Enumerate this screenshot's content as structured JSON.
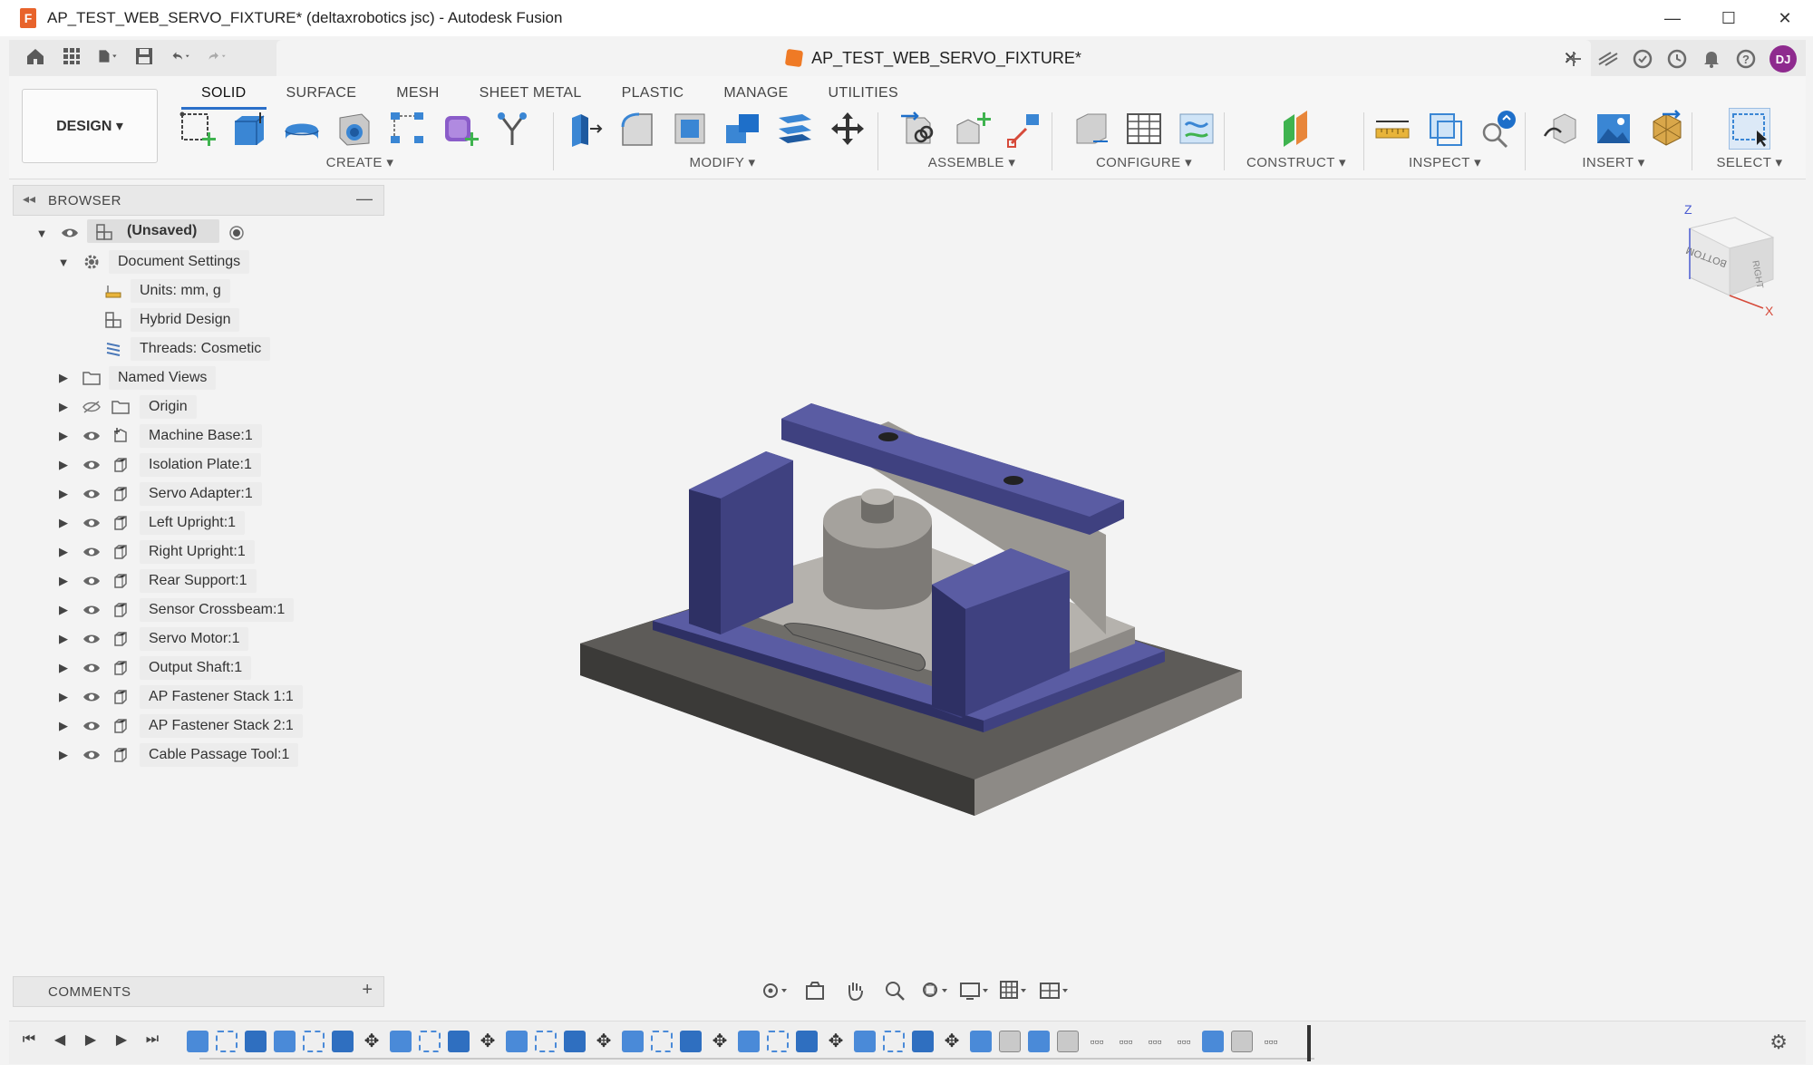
{
  "window": {
    "title": "AP_TEST_WEB_SERVO_FIXTURE* (deltaxrobotics jsc) - Autodesk Fusion",
    "logo_letter": "F",
    "minimize": "—",
    "maximize": "☐",
    "close": "✕"
  },
  "document_tab": {
    "title": "AP_TEST_WEB_SERVO_FIXTURE*",
    "close": "✕"
  },
  "user": {
    "initials": "DJ"
  },
  "toolbar": {
    "workspace_button": "DESIGN ▾",
    "tabs": [
      "SOLID",
      "SURFACE",
      "MESH",
      "SHEET METAL",
      "PLASTIC",
      "MANAGE",
      "UTILITIES"
    ],
    "active_tab": "SOLID",
    "groups": {
      "create": "CREATE ▾",
      "modify": "MODIFY ▾",
      "assemble": "ASSEMBLE ▾",
      "configure": "CONFIGURE ▾",
      "construct": "CONSTRUCT ▾",
      "inspect": "INSPECT ▾",
      "insert": "INSERT ▾",
      "select": "SELECT ▾"
    }
  },
  "browser": {
    "title": "BROWSER",
    "root": "(Unsaved)",
    "document_settings": "Document Settings",
    "settings": [
      {
        "label": "Units: mm, g",
        "icon": "ruler-icon"
      },
      {
        "label": "Hybrid Design",
        "icon": "hybrid-design-icon"
      },
      {
        "label": "Threads: Cosmetic",
        "icon": "thread-icon"
      }
    ],
    "named_views": "Named Views",
    "origin": "Origin",
    "components": [
      "Machine Base:1",
      "Isolation Plate:1",
      "Servo Adapter:1",
      "Left Upright:1",
      "Right Upright:1",
      "Rear Support:1",
      "Sensor Crossbeam:1",
      "Servo Motor:1",
      "Output Shaft:1",
      "AP Fastener Stack 1:1",
      "AP Fastener Stack 2:1",
      "Cable Passage Tool:1"
    ]
  },
  "comments": {
    "title": "COMMENTS",
    "add": "+"
  },
  "viewcube": {
    "z": "Z",
    "x": "X",
    "face_front": "BOTTOM",
    "face_right": "RIGHT"
  },
  "colors": {
    "accent": "#2b6fc9",
    "model_blue": "#3f4180",
    "model_gray": "#8d8a86",
    "base_dark": "#4a4947",
    "avatar": "#8e2a8e"
  }
}
